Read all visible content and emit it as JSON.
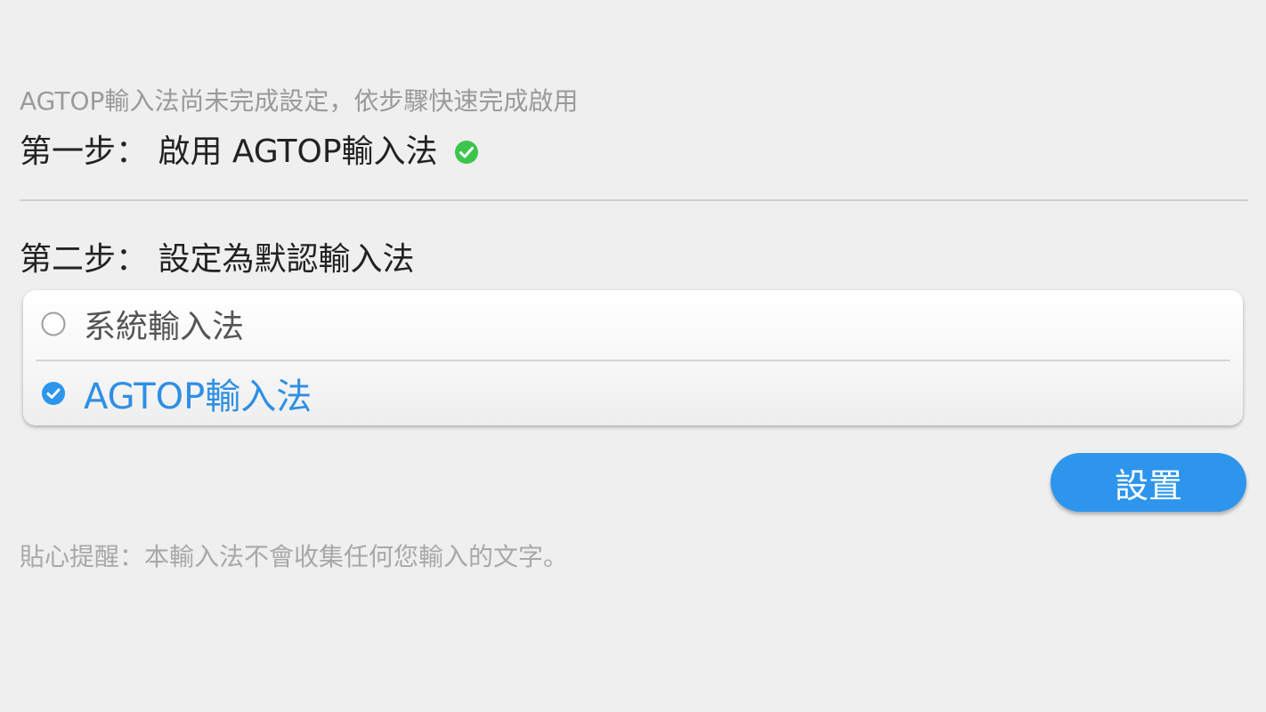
{
  "setup": {
    "intro_text": "AGTOP輸入法尚未完成設定，依步驟快速完成啟用",
    "step1": {
      "label": "第一步： 啟用 AGTOP輸入法",
      "status_icon": "check-circle-icon",
      "status_color": "#3cc44b"
    },
    "step2": {
      "label": "第二步： 設定為默認輸入法"
    },
    "options": [
      {
        "label": "系統輸入法",
        "selected": false,
        "icon": "radio-unchecked-icon"
      },
      {
        "label": "AGTOP輸入法",
        "selected": true,
        "icon": "radio-checked-icon"
      }
    ],
    "set_button_label": "設置",
    "reminder_text": "貼心提醒：本輸入法不會收集任何您輸入的文字。"
  },
  "colors": {
    "background": "#efefef",
    "accent_blue": "#2d96ec",
    "selected_text": "#2f8fe3",
    "success_green": "#3cc44b"
  }
}
